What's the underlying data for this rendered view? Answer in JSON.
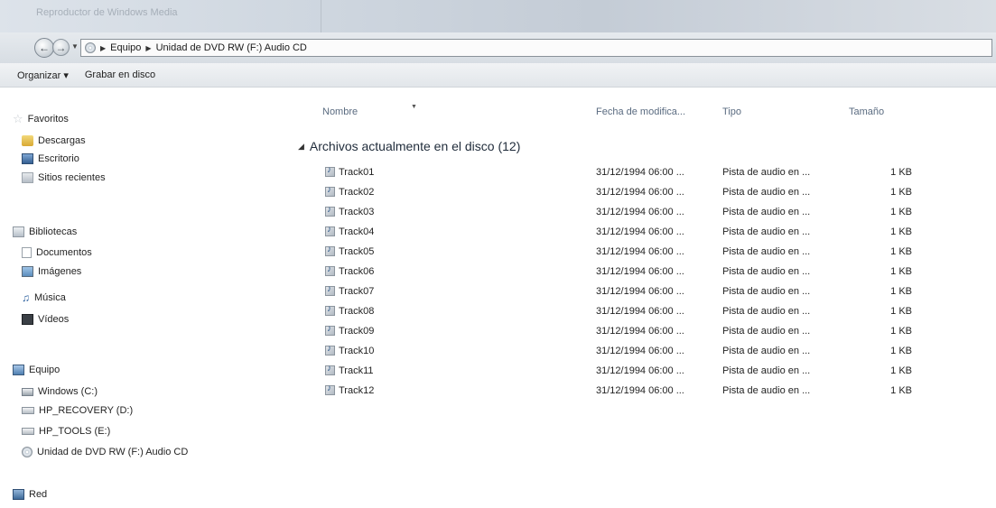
{
  "window": {
    "title": "Reproductor de Windows Media"
  },
  "nav": {
    "back_icon": "back-arrow-icon",
    "forward_icon": "forward-arrow-icon",
    "breadcrumb": [
      "Equipo",
      "Unidad de DVD RW (F:) Audio CD"
    ]
  },
  "toolbar": {
    "organize_label": "Organizar ▾",
    "burn_label": "Grabar en disco"
  },
  "sidebar": {
    "favorites": {
      "label": "Favoritos",
      "items": [
        "Descargas",
        "Escritorio",
        "Sitios recientes"
      ]
    },
    "libraries": {
      "label": "Bibliotecas",
      "items": [
        "Documentos",
        "Imágenes",
        "Música",
        "Vídeos"
      ]
    },
    "computer": {
      "label": "Equipo",
      "items": [
        "Windows (C:)",
        "HP_RECOVERY (D:)",
        "HP_TOOLS (E:)",
        "Unidad de DVD RW (F:) Audio CD"
      ]
    },
    "network": {
      "label": "Red"
    }
  },
  "columns": {
    "name": "Nombre",
    "date": "Fecha de modifica...",
    "type": "Tipo",
    "size": "Tamaño"
  },
  "group": {
    "label": "Archivos actualmente en el disco (12)"
  },
  "files": [
    {
      "name": "Track01",
      "date": "31/12/1994 06:00 ...",
      "type": "Pista de audio en ...",
      "size": "1 KB"
    },
    {
      "name": "Track02",
      "date": "31/12/1994 06:00 ...",
      "type": "Pista de audio en ...",
      "size": "1 KB"
    },
    {
      "name": "Track03",
      "date": "31/12/1994 06:00 ...",
      "type": "Pista de audio en ...",
      "size": "1 KB"
    },
    {
      "name": "Track04",
      "date": "31/12/1994 06:00 ...",
      "type": "Pista de audio en ...",
      "size": "1 KB"
    },
    {
      "name": "Track05",
      "date": "31/12/1994 06:00 ...",
      "type": "Pista de audio en ...",
      "size": "1 KB"
    },
    {
      "name": "Track06",
      "date": "31/12/1994 06:00 ...",
      "type": "Pista de audio en ...",
      "size": "1 KB"
    },
    {
      "name": "Track07",
      "date": "31/12/1994 06:00 ...",
      "type": "Pista de audio en ...",
      "size": "1 KB"
    },
    {
      "name": "Track08",
      "date": "31/12/1994 06:00 ...",
      "type": "Pista de audio en ...",
      "size": "1 KB"
    },
    {
      "name": "Track09",
      "date": "31/12/1994 06:00 ...",
      "type": "Pista de audio en ...",
      "size": "1 KB"
    },
    {
      "name": "Track10",
      "date": "31/12/1994 06:00 ...",
      "type": "Pista de audio en ...",
      "size": "1 KB"
    },
    {
      "name": "Track11",
      "date": "31/12/1994 06:00 ...",
      "type": "Pista de audio en ...",
      "size": "1 KB"
    },
    {
      "name": "Track12",
      "date": "31/12/1994 06:00 ...",
      "type": "Pista de audio en ...",
      "size": "1 KB"
    }
  ]
}
